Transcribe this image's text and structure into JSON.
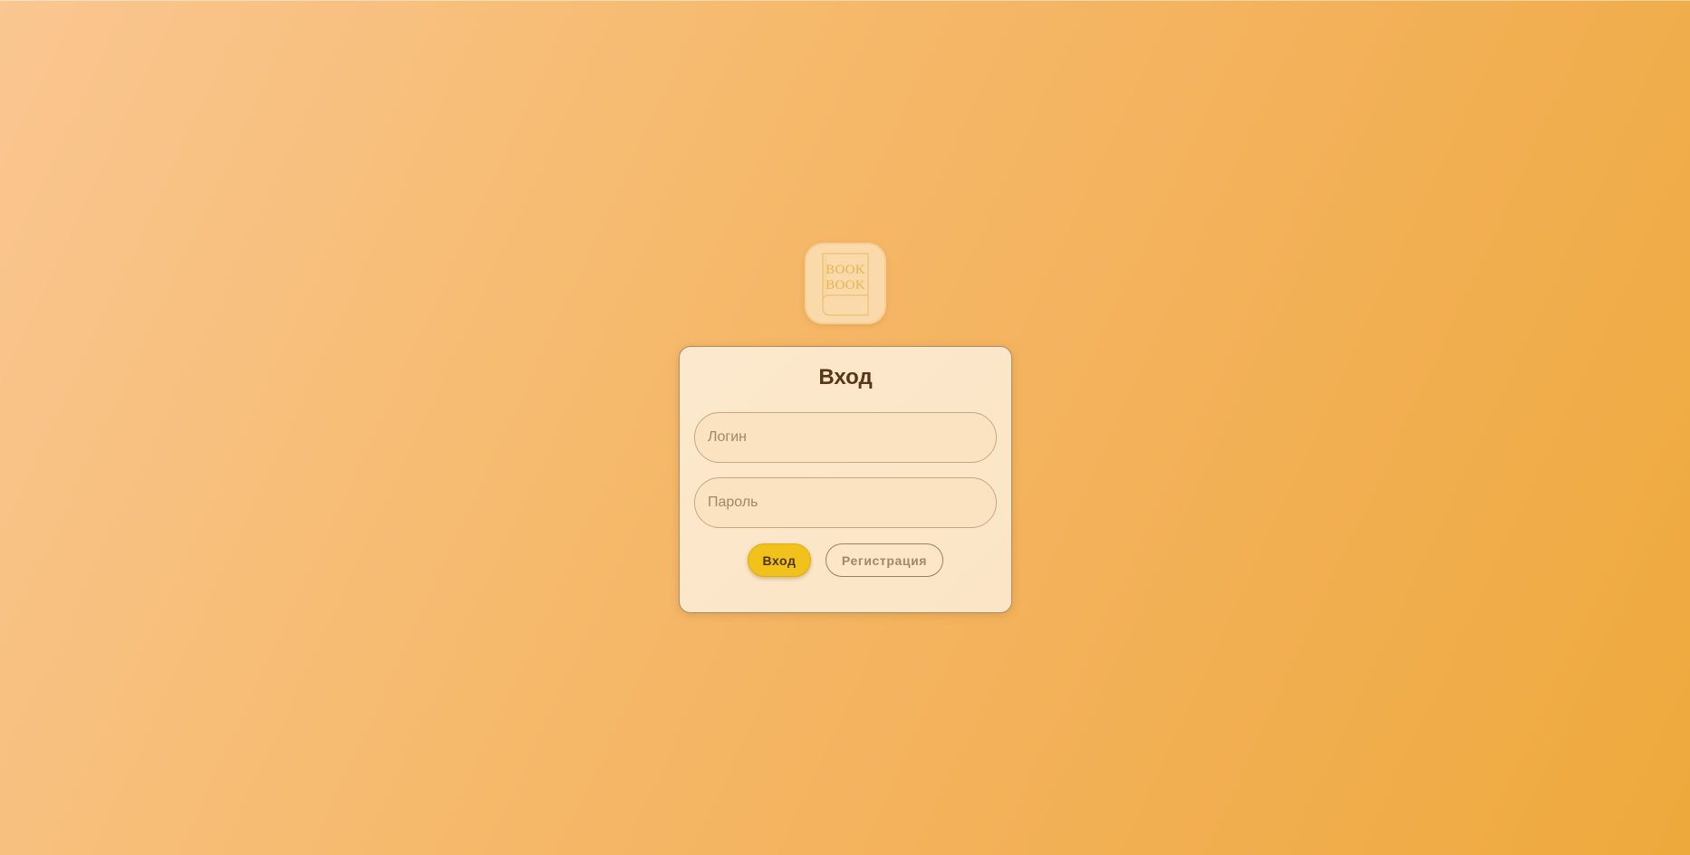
{
  "logo": {
    "icon": "book-icon",
    "line1": "BOOK",
    "line2": "BOOK",
    "color": "#e8b64a"
  },
  "login_form": {
    "title": "Вход",
    "login_placeholder": "Логин",
    "login_value": "",
    "password_placeholder": "Пароль",
    "password_value": "",
    "submit_label": "Вход",
    "register_label": "Регистрация"
  },
  "colors": {
    "background_start": "#fac691",
    "background_end": "#eea93c",
    "card_background": "#fce8cc",
    "title_text": "#5a3618",
    "primary_button": "#f2c21c"
  }
}
